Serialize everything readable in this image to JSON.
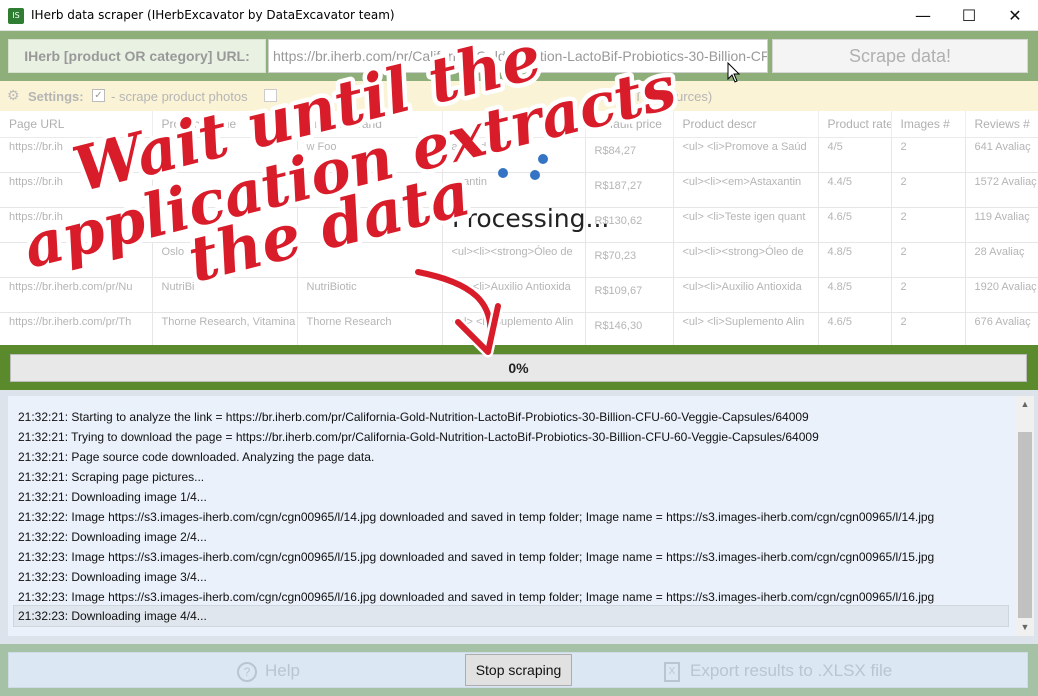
{
  "window": {
    "icon_text": "IS",
    "title": "IHerb data scraper (IHerbExcavator by DataExcavator team)",
    "minimize": "—",
    "maximize": "☐",
    "close": "✕"
  },
  "url_bar": {
    "label": "IHerb [product OR category] URL:",
    "value": "https://br.iherb.com/pr/California-Gold-Nutrition-LactoBif-Probiotics-30-Billion-CFU-60-Veggie-Capsules/64009",
    "scrape_label": "Scrape data!"
  },
  "settings": {
    "icon": "gear-icon",
    "label": "Settings:",
    "scrape_photos_checked": true,
    "scrape_photos_label": "- scrape product photos",
    "folder_text": "avator/HTMLSources)"
  },
  "grid": {
    "columns": [
      "Page URL",
      "Product name",
      "",
      "Product brand",
      "",
      "Default price",
      "Product descr",
      "Product rate",
      "Images #",
      "Reviews #"
    ],
    "rows": [
      {
        "url": "https://br.ih",
        "name": "",
        "brand": "w Foo",
        "desc1": "a Saúd",
        "price": "R$84,27",
        "descr": "<ul> <li>Promove a Saúd",
        "rate": "4/5",
        "images": "2",
        "reviews": "641 Avaliaç"
      },
      {
        "url": "https://br.ih",
        "name": "",
        "brand": "",
        "desc1": "axantin",
        "price": "R$187,27",
        "descr": "<ul><li><em>Astaxantin",
        "rate": "4.4/5",
        "images": "2",
        "reviews": "1572 Avaliaç"
      },
      {
        "url": "https://br.ih",
        "name": "",
        "brand": "",
        "desc1": "",
        "price": "R$130,62",
        "descr": "<ul> <li>Teste igen quant",
        "rate": "4.6/5",
        "images": "2",
        "reviews": "119 Avaliaç"
      },
      {
        "url": "",
        "name": "Oslo",
        "brand": "",
        "desc1": "<ul><li><strong>Óleo de",
        "price": "R$70,23",
        "descr": "<ul><li><strong>Óleo de",
        "rate": "4.8/5",
        "images": "2",
        "reviews": "28 Avaliaç"
      },
      {
        "url": "https://br.iherb.com/pr/Nu",
        "name": "NutriBi",
        "brand": "NutriBiotic",
        "desc1": "<ul><li>Auxilio Antioxida",
        "price": "R$109,67",
        "descr": "<ul><li>Auxilio Antioxida",
        "rate": "4.8/5",
        "images": "2",
        "reviews": "1920 Avaliaç"
      },
      {
        "url": "https://br.iherb.com/pr/Th",
        "name": "Thorne Research, Vitamina",
        "brand": "Thorne Research",
        "desc1": "<ul> <li>Suplemento Alin",
        "price": "R$146,30",
        "descr": "<ul> <li>Suplemento Alin",
        "rate": "4.6/5",
        "images": "2",
        "reviews": "676 Avaliaç"
      }
    ]
  },
  "processing": {
    "label": "Processing..."
  },
  "progress": {
    "value": 0,
    "label": "0%"
  },
  "log": {
    "lines": [
      "21:32:21: Starting to analyze the link = https://br.iherb.com/pr/California-Gold-Nutrition-LactoBif-Probiotics-30-Billion-CFU-60-Veggie-Capsules/64009",
      "21:32:21: Trying to download the page = https://br.iherb.com/pr/California-Gold-Nutrition-LactoBif-Probiotics-30-Billion-CFU-60-Veggie-Capsules/64009",
      "21:32:21: Page source code downloaded. Analyzing the page data.",
      "21:32:21: Scraping page pictures...",
      "21:32:21: Downloading image 1/4...",
      "21:32:22: Image https://s3.images-iherb.com/cgn/cgn00965/l/14.jpg downloaded and saved in temp folder; Image name = https://s3.images-iherb.com/cgn/cgn00965/l/14.jpg",
      "21:32:22: Downloading image 2/4...",
      "21:32:23: Image https://s3.images-iherb.com/cgn/cgn00965/l/15.jpg downloaded and saved in temp folder; Image name = https://s3.images-iherb.com/cgn/cgn00965/l/15.jpg",
      "21:32:23: Downloading image 3/4...",
      "21:32:23: Image https://s3.images-iherb.com/cgn/cgn00965/l/16.jpg downloaded and saved in temp folder; Image name = https://s3.images-iherb.com/cgn/cgn00965/l/16.jpg",
      "21:32:23: Downloading image 4/4..."
    ]
  },
  "bottom": {
    "help_icon": "question-icon",
    "help_label": "Help",
    "stop_label": "Stop scraping",
    "export_icon": "excel-icon",
    "export_label": "Export results to .XLSX file"
  },
  "annotation": {
    "lines": [
      "Wait until the",
      "application extracts",
      "the data"
    ],
    "text_color": "#d81c2a",
    "outline_color": "#ffffff"
  },
  "colors": {
    "url_bar_bg": "#8eae7a",
    "settings_bg": "#fbf3d5",
    "progress_frame": "#5a8a2b",
    "log_bg": "#eaf1fb",
    "spinner": "#3574c4"
  }
}
